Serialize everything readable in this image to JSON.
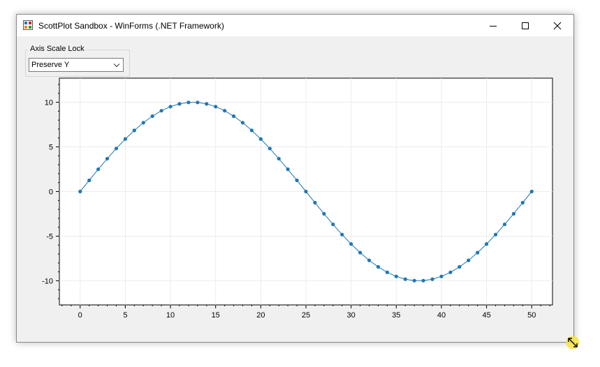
{
  "window": {
    "title": "ScottPlot Sandbox - WinForms (.NET Framework)",
    "icons": {
      "app": "scottplot-app-icon",
      "minimize": "minimize-icon",
      "maximize": "maximize-icon",
      "close": "close-icon"
    }
  },
  "axis_scale_lock": {
    "group_label": "Axis Scale Lock",
    "selected": "Preserve Y",
    "dropdown_icon": "chevron-down-icon"
  },
  "colors": {
    "series": "#1f77b4",
    "grid": "#ececec",
    "plot_background": "#ffffff",
    "form_background": "#f0f0f0"
  },
  "chart_data": {
    "type": "scatter",
    "title": "",
    "xlabel": "",
    "ylabel": "",
    "xlim": [
      -2.3,
      52.3
    ],
    "ylim": [
      -12.7,
      12.7
    ],
    "grid": true,
    "x_ticks": [
      0,
      5,
      10,
      15,
      20,
      25,
      30,
      35,
      40,
      45,
      50
    ],
    "y_ticks": [
      -10,
      -5,
      0,
      5,
      10
    ],
    "x_tick_labels": [
      "0",
      "5",
      "10",
      "15",
      "20",
      "25",
      "30",
      "35",
      "40",
      "45",
      "50"
    ],
    "y_tick_labels": [
      "-10",
      "-5",
      "0",
      "5",
      "10"
    ],
    "series": [
      {
        "marker": "circle",
        "line": true,
        "x": [
          0,
          1,
          2,
          3,
          4,
          5,
          6,
          7,
          8,
          9,
          10,
          11,
          12,
          13,
          14,
          15,
          16,
          17,
          18,
          19,
          20,
          21,
          22,
          23,
          24,
          25,
          26,
          27,
          28,
          29,
          30,
          31,
          32,
          33,
          34,
          35,
          36,
          37,
          38,
          39,
          40,
          41,
          42,
          43,
          44,
          45,
          46,
          47,
          48,
          49,
          50
        ],
        "y": [
          0.0,
          1.25,
          2.49,
          3.68,
          4.82,
          5.88,
          6.85,
          7.71,
          8.44,
          9.05,
          9.51,
          9.82,
          9.98,
          9.98,
          9.82,
          9.51,
          9.05,
          8.44,
          7.71,
          6.85,
          5.88,
          4.82,
          3.68,
          2.49,
          1.25,
          0.0,
          -1.25,
          -2.49,
          -3.68,
          -4.82,
          -5.88,
          -6.85,
          -7.71,
          -8.44,
          -9.05,
          -9.51,
          -9.82,
          -9.98,
          -9.98,
          -9.82,
          -9.51,
          -9.05,
          -8.44,
          -7.71,
          -6.85,
          -5.88,
          -4.82,
          -3.68,
          -2.49,
          -1.25,
          0.0
        ]
      }
    ]
  }
}
